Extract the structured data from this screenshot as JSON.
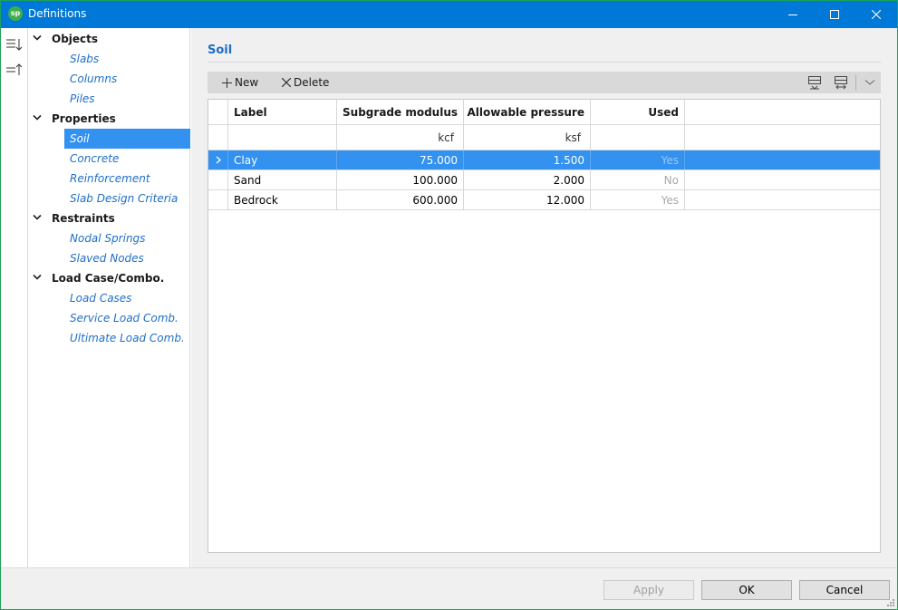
{
  "window": {
    "title": "Definitions",
    "app_icon_text": "sp",
    "accent_color": "#0078d7"
  },
  "left_strip": {
    "icons": [
      "sort-descending-icon",
      "sort-ascending-icon"
    ]
  },
  "tree": {
    "groups": [
      {
        "label": "Objects",
        "items": [
          "Slabs",
          "Columns",
          "Piles"
        ]
      },
      {
        "label": "Properties",
        "items": [
          "Soil",
          "Concrete",
          "Reinforcement",
          "Slab Design Criteria"
        ]
      },
      {
        "label": "Restraints",
        "items": [
          "Nodal Springs",
          "Slaved Nodes"
        ]
      },
      {
        "label": "Load Case/Combo.",
        "items": [
          "Load Cases",
          "Service Load Comb.",
          "Ultimate Load Comb."
        ]
      }
    ],
    "selected_item": "Soil"
  },
  "section": {
    "title": "Soil"
  },
  "toolbar": {
    "new_label": "New",
    "delete_label": "Delete"
  },
  "table": {
    "columns": [
      "Label",
      "Subgrade modulus",
      "Allowable pressure",
      "Used"
    ],
    "units": [
      "",
      "kcf",
      "ksf",
      ""
    ],
    "rows": [
      {
        "label": "Clay",
        "subgrade_modulus": "75.000",
        "allowable_pressure": "1.500",
        "used": "Yes"
      },
      {
        "label": "Sand",
        "subgrade_modulus": "100.000",
        "allowable_pressure": "2.000",
        "used": "No"
      },
      {
        "label": "Bedrock",
        "subgrade_modulus": "600.000",
        "allowable_pressure": "12.000",
        "used": "Yes"
      }
    ],
    "selected_row": 0
  },
  "footer": {
    "apply_label": "Apply",
    "ok_label": "OK",
    "cancel_label": "Cancel"
  }
}
